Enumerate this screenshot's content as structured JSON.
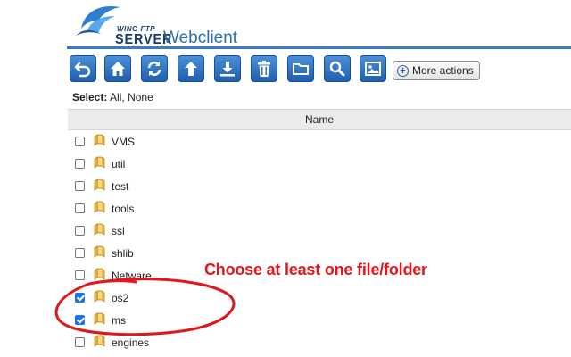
{
  "app": {
    "logo_small": "WING FTP",
    "logo_big": "SERVER",
    "title": "Webclient"
  },
  "toolbar": {
    "buttons": [
      {
        "name": "back-button",
        "icon": "back-arrow-icon"
      },
      {
        "name": "home-button",
        "icon": "home-icon"
      },
      {
        "name": "refresh-button",
        "icon": "refresh-icon"
      },
      {
        "name": "upload-button",
        "icon": "upload-icon"
      },
      {
        "name": "download-button",
        "icon": "download-icon"
      },
      {
        "name": "delete-button",
        "icon": "trash-icon"
      },
      {
        "name": "new-folder-button",
        "icon": "folder-icon"
      },
      {
        "name": "search-button",
        "icon": "search-icon"
      },
      {
        "name": "image-view-button",
        "icon": "image-icon"
      }
    ],
    "more_actions_label": "More actions"
  },
  "select": {
    "label": "Select:",
    "all": "All",
    "separator": ",",
    "none": "None"
  },
  "table": {
    "column_name": "Name",
    "rows": [
      {
        "name": "VMS",
        "checked": false
      },
      {
        "name": "util",
        "checked": false
      },
      {
        "name": "test",
        "checked": false
      },
      {
        "name": "tools",
        "checked": false
      },
      {
        "name": "ssl",
        "checked": false
      },
      {
        "name": "shlib",
        "checked": false
      },
      {
        "name": "Netware",
        "checked": false
      },
      {
        "name": "os2",
        "checked": true
      },
      {
        "name": "ms",
        "checked": true
      },
      {
        "name": "engines",
        "checked": false
      }
    ]
  },
  "annotation": {
    "text": "Choose at least one file/folder",
    "color": "#e0171b"
  },
  "colors": {
    "accent": "#3a7cc4",
    "button_blue": "#2a6fb8"
  }
}
